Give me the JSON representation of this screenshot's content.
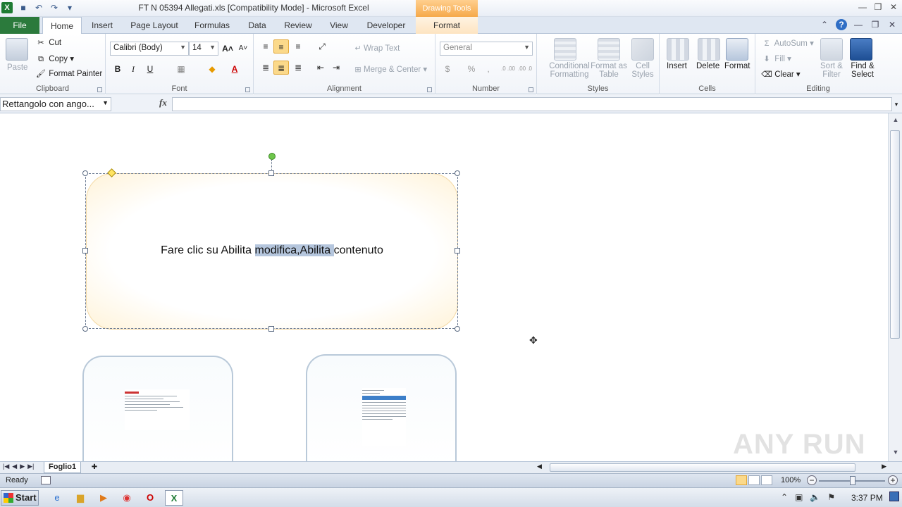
{
  "window": {
    "title": "FT N 05394 Allegati.xls  [Compatibility Mode]  -  Microsoft Excel",
    "context_tab_group": "Drawing Tools"
  },
  "tabs": [
    "File",
    "Home",
    "Insert",
    "Page Layout",
    "Formulas",
    "Data",
    "Review",
    "View",
    "Developer",
    "Format"
  ],
  "active_tab": "Home",
  "ribbon": {
    "clipboard": {
      "label": "Clipboard",
      "paste": "Paste",
      "cut": "Cut",
      "copy": "Copy",
      "format_painter": "Format Painter"
    },
    "font": {
      "label": "Font",
      "font_name": "Calibri (Body)",
      "font_size": "14",
      "bold": "B",
      "italic": "I",
      "underline": "U"
    },
    "alignment": {
      "label": "Alignment",
      "wrap_text": "Wrap Text",
      "merge_center": "Merge & Center"
    },
    "number": {
      "label": "Number",
      "format": "General",
      "currency": "$",
      "percent": "%",
      "comma": ",",
      "inc_decimal": ".0 .00",
      "dec_decimal": ".00 .0"
    },
    "styles": {
      "label": "Styles",
      "conditional": "Conditional Formatting",
      "format_table": "Format as Table",
      "cell_styles": "Cell Styles"
    },
    "cells": {
      "label": "Cells",
      "insert": "Insert",
      "delete": "Delete",
      "format": "Format"
    },
    "editing": {
      "label": "Editing",
      "autosum": "AutoSum",
      "fill": "Fill",
      "clear": "Clear",
      "sort_filter": "Sort & Filter",
      "find_select": "Find & Select"
    }
  },
  "formula_bar": {
    "name_box": "Rettangolo con ango...",
    "fx": "fx",
    "value": ""
  },
  "shape": {
    "text_before": "Fare clic su Abilita ",
    "text_highlight": "modifica,Abilita ",
    "text_after": "contenuto"
  },
  "sheet_tabs": [
    "Foglio1"
  ],
  "status": {
    "ready": "Ready",
    "zoom": "100%"
  },
  "watermark": "ANY RUN",
  "taskbar": {
    "start": "Start",
    "clock": "3:37 PM"
  }
}
